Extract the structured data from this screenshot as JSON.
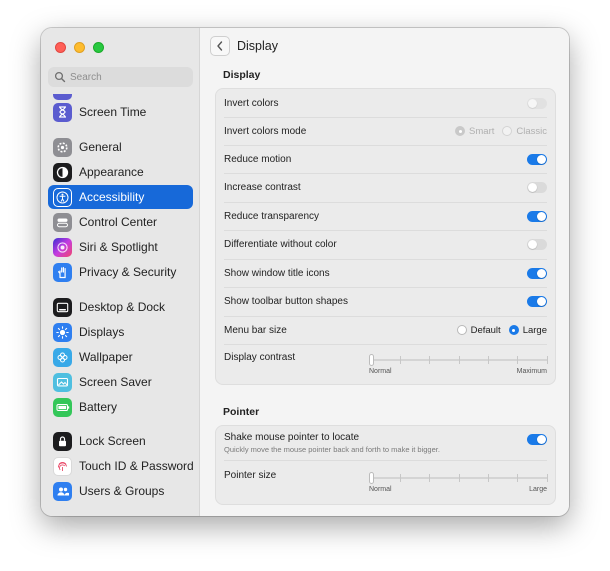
{
  "window": {
    "title": "Display"
  },
  "search": {
    "placeholder": "Search"
  },
  "sidebar": {
    "items": [
      {
        "label": "Screen Time",
        "icon": "hourglass-icon",
        "color": "#5b5ccf"
      },
      {
        "label": "General",
        "icon": "gear-icon",
        "color": "#8e8e93"
      },
      {
        "label": "Appearance",
        "icon": "appearance-icon",
        "color": "#1c1c1e"
      },
      {
        "label": "Accessibility",
        "icon": "accessibility-icon",
        "color": "#1769d9",
        "selected": true
      },
      {
        "label": "Control Center",
        "icon": "control-center-icon",
        "color": "#8e8e93"
      },
      {
        "label": "Siri & Spotlight",
        "icon": "siri-icon",
        "color": "#c43be0"
      },
      {
        "label": "Privacy & Security",
        "icon": "hand-icon",
        "color": "#2f7ff0"
      },
      {
        "label": "Desktop & Dock",
        "icon": "dock-icon",
        "color": "#1c1c1e"
      },
      {
        "label": "Displays",
        "icon": "sun-icon",
        "color": "#2f7ff0"
      },
      {
        "label": "Wallpaper",
        "icon": "wallpaper-icon",
        "color": "#38a9e8"
      },
      {
        "label": "Screen Saver",
        "icon": "screen-saver-icon",
        "color": "#4fbfe0"
      },
      {
        "label": "Battery",
        "icon": "battery-icon",
        "color": "#34c759"
      },
      {
        "label": "Lock Screen",
        "icon": "lock-icon",
        "color": "#1c1c1e"
      },
      {
        "label": "Touch ID & Password",
        "icon": "fingerprint-icon",
        "color": "#ffffff"
      },
      {
        "label": "Users & Groups",
        "icon": "users-icon",
        "color": "#2f7ff0"
      }
    ]
  },
  "display_section": {
    "title": "Display",
    "rows": [
      {
        "label": "Invert colors",
        "type": "toggle",
        "on": false,
        "enabled": false
      },
      {
        "label": "Invert colors mode",
        "type": "radio",
        "options": [
          "Smart",
          "Classic"
        ],
        "selected": "Smart",
        "enabled": false
      },
      {
        "label": "Reduce motion",
        "type": "toggle",
        "on": true,
        "enabled": true
      },
      {
        "label": "Increase contrast",
        "type": "toggle",
        "on": false,
        "enabled": true
      },
      {
        "label": "Reduce transparency",
        "type": "toggle",
        "on": true,
        "enabled": true
      },
      {
        "label": "Differentiate without color",
        "type": "toggle",
        "on": false,
        "enabled": true
      },
      {
        "label": "Show window title icons",
        "type": "toggle",
        "on": true,
        "enabled": true
      },
      {
        "label": "Show toolbar button shapes",
        "type": "toggle",
        "on": true,
        "enabled": true
      },
      {
        "label": "Menu bar size",
        "type": "radio",
        "options": [
          "Default",
          "Large"
        ],
        "selected": "Large",
        "enabled": true
      }
    ],
    "contrast": {
      "label": "Display contrast",
      "min_label": "Normal",
      "max_label": "Maximum",
      "value": 0
    }
  },
  "pointer_section": {
    "title": "Pointer",
    "shake": {
      "label": "Shake mouse pointer to locate",
      "description": "Quickly move the mouse pointer back and forth to make it bigger.",
      "on": true
    },
    "size": {
      "label": "Pointer size",
      "min_label": "Normal",
      "max_label": "Large",
      "value": 0
    }
  },
  "accent_color": "#1a7ae8"
}
